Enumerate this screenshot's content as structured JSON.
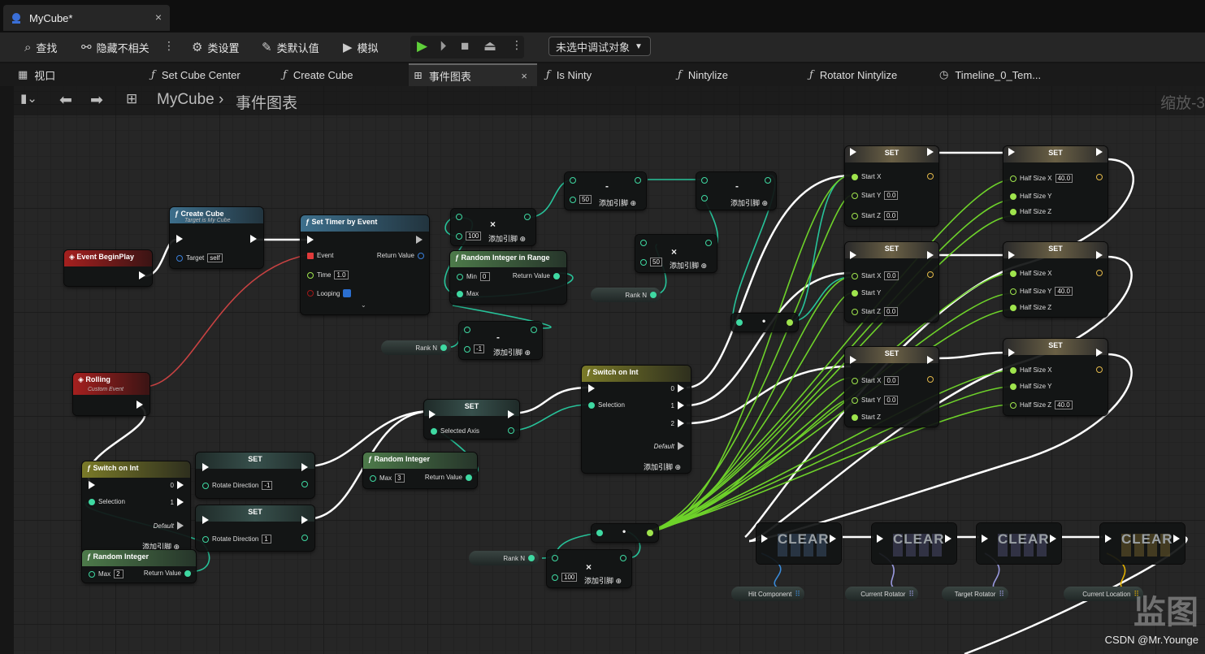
{
  "window": {
    "doc_tab": "MyCube*",
    "close": "×"
  },
  "toolbar": {
    "find": "查找",
    "hide_unrelated": "隐藏不相关",
    "class_settings": "类设置",
    "class_defaults": "类默认值",
    "simulate": "模拟",
    "debug_object": "未选中调试对象"
  },
  "tabs": [
    {
      "label": "视口",
      "icon": "viewport-icon"
    },
    {
      "label": "Set Cube Center",
      "icon": "function-icon"
    },
    {
      "label": "Create Cube",
      "icon": "function-icon"
    },
    {
      "label": "事件图表",
      "icon": "graph-icon"
    },
    {
      "label": "Is Ninty",
      "icon": "function-icon"
    },
    {
      "label": "Nintylize",
      "icon": "function-icon"
    },
    {
      "label": "Rotator Nintylize",
      "icon": "function-icon"
    },
    {
      "label": "Timeline_0_Tem...",
      "icon": "clock-icon"
    }
  ],
  "breadcrumb": {
    "root": "MyCube",
    "sep": "›",
    "current": "事件图表",
    "zoom": "缩放-3"
  },
  "nodes": {
    "begin_play": "Event BeginPlay",
    "create_cube": {
      "title": "Create Cube",
      "sub": "Target is My Cube",
      "target": "Target",
      "target_val": "self"
    },
    "set_timer": {
      "title": "Set Timer by Event",
      "event": "Event",
      "ret": "Return Value",
      "time": "Time",
      "time_val": "1.0",
      "looping": "Looping"
    },
    "rolling": {
      "title": "Rolling",
      "sub": "Custom Event"
    },
    "rand_range": {
      "title": "Random Integer in Range",
      "min": "Min",
      "min_val": "0",
      "max": "Max",
      "ret": "Return Value"
    },
    "mul1": {
      "op": "×",
      "val": "100",
      "add": "添加引脚"
    },
    "sub1": {
      "op": "-",
      "val": "50",
      "add": "添加引脚"
    },
    "sub2": {
      "op": "-",
      "add": "添加引脚"
    },
    "mul2": {
      "op": "×",
      "val": "50",
      "add": "添加引脚"
    },
    "sub3": {
      "op": "-",
      "val": "-1",
      "add": "添加引脚"
    },
    "mul3": {
      "op": "×",
      "val": "100",
      "add": "添加引脚"
    },
    "rank": "Rank N",
    "switch1": {
      "title": "Switch on Int",
      "sel": "Selection",
      "p0": "0",
      "p1": "1",
      "def": "Default",
      "add": "添加引脚"
    },
    "switch2": {
      "title": "Switch on Int",
      "sel": "Selection",
      "p0": "0",
      "p1": "1",
      "p2": "2",
      "def": "Default",
      "add": "添加引脚"
    },
    "rand_int": {
      "title": "Random Integer",
      "max": "Max",
      "max_val": "2",
      "ret": "Return Value"
    },
    "rand_int2": {
      "title": "Random Integer",
      "max": "Max",
      "max_val": "3",
      "ret": "Return Value"
    },
    "set_rot1": {
      "title": "SET",
      "label": "Rotate Direction",
      "val": "-1"
    },
    "set_rot2": {
      "title": "SET",
      "label": "Rotate Direction",
      "val": "1"
    },
    "set_axis": {
      "title": "SET",
      "label": "Selected Axis"
    },
    "set_start_a": {
      "title": "SET",
      "x": "Start X",
      "y": "Start Y",
      "y_val": "0.0",
      "z": "Start Z",
      "z_val": "0.0"
    },
    "set_start_b": {
      "title": "SET",
      "x": "Start X",
      "x_val": "0.0",
      "y": "Start Y",
      "z": "Start Z",
      "z_val": "0.0"
    },
    "set_start_c": {
      "title": "SET",
      "x": "Start X",
      "x_val": "0.0",
      "y": "Start Y",
      "y_val": "0.0",
      "z": "Start Z"
    },
    "set_half_a": {
      "title": "SET",
      "x": "Half Size X",
      "x_val": "40.0",
      "y": "Half Size Y",
      "z": "Half Size Z"
    },
    "set_half_b": {
      "title": "SET",
      "x": "Half Size X",
      "y": "Half Size Y",
      "y_val": "40.0",
      "z": "Half Size Z"
    },
    "set_half_c": {
      "title": "SET",
      "x": "Half Size X",
      "y": "Half Size Y",
      "z": "Half Size Z",
      "z_val": "40.0"
    },
    "clear": "CLEAR",
    "vars": [
      "Hit Component",
      "Current Rotator",
      "Target Rotator",
      "Current Location"
    ]
  },
  "watermark": "CSDN @Mr.Younge",
  "watermark_logo": "监图"
}
